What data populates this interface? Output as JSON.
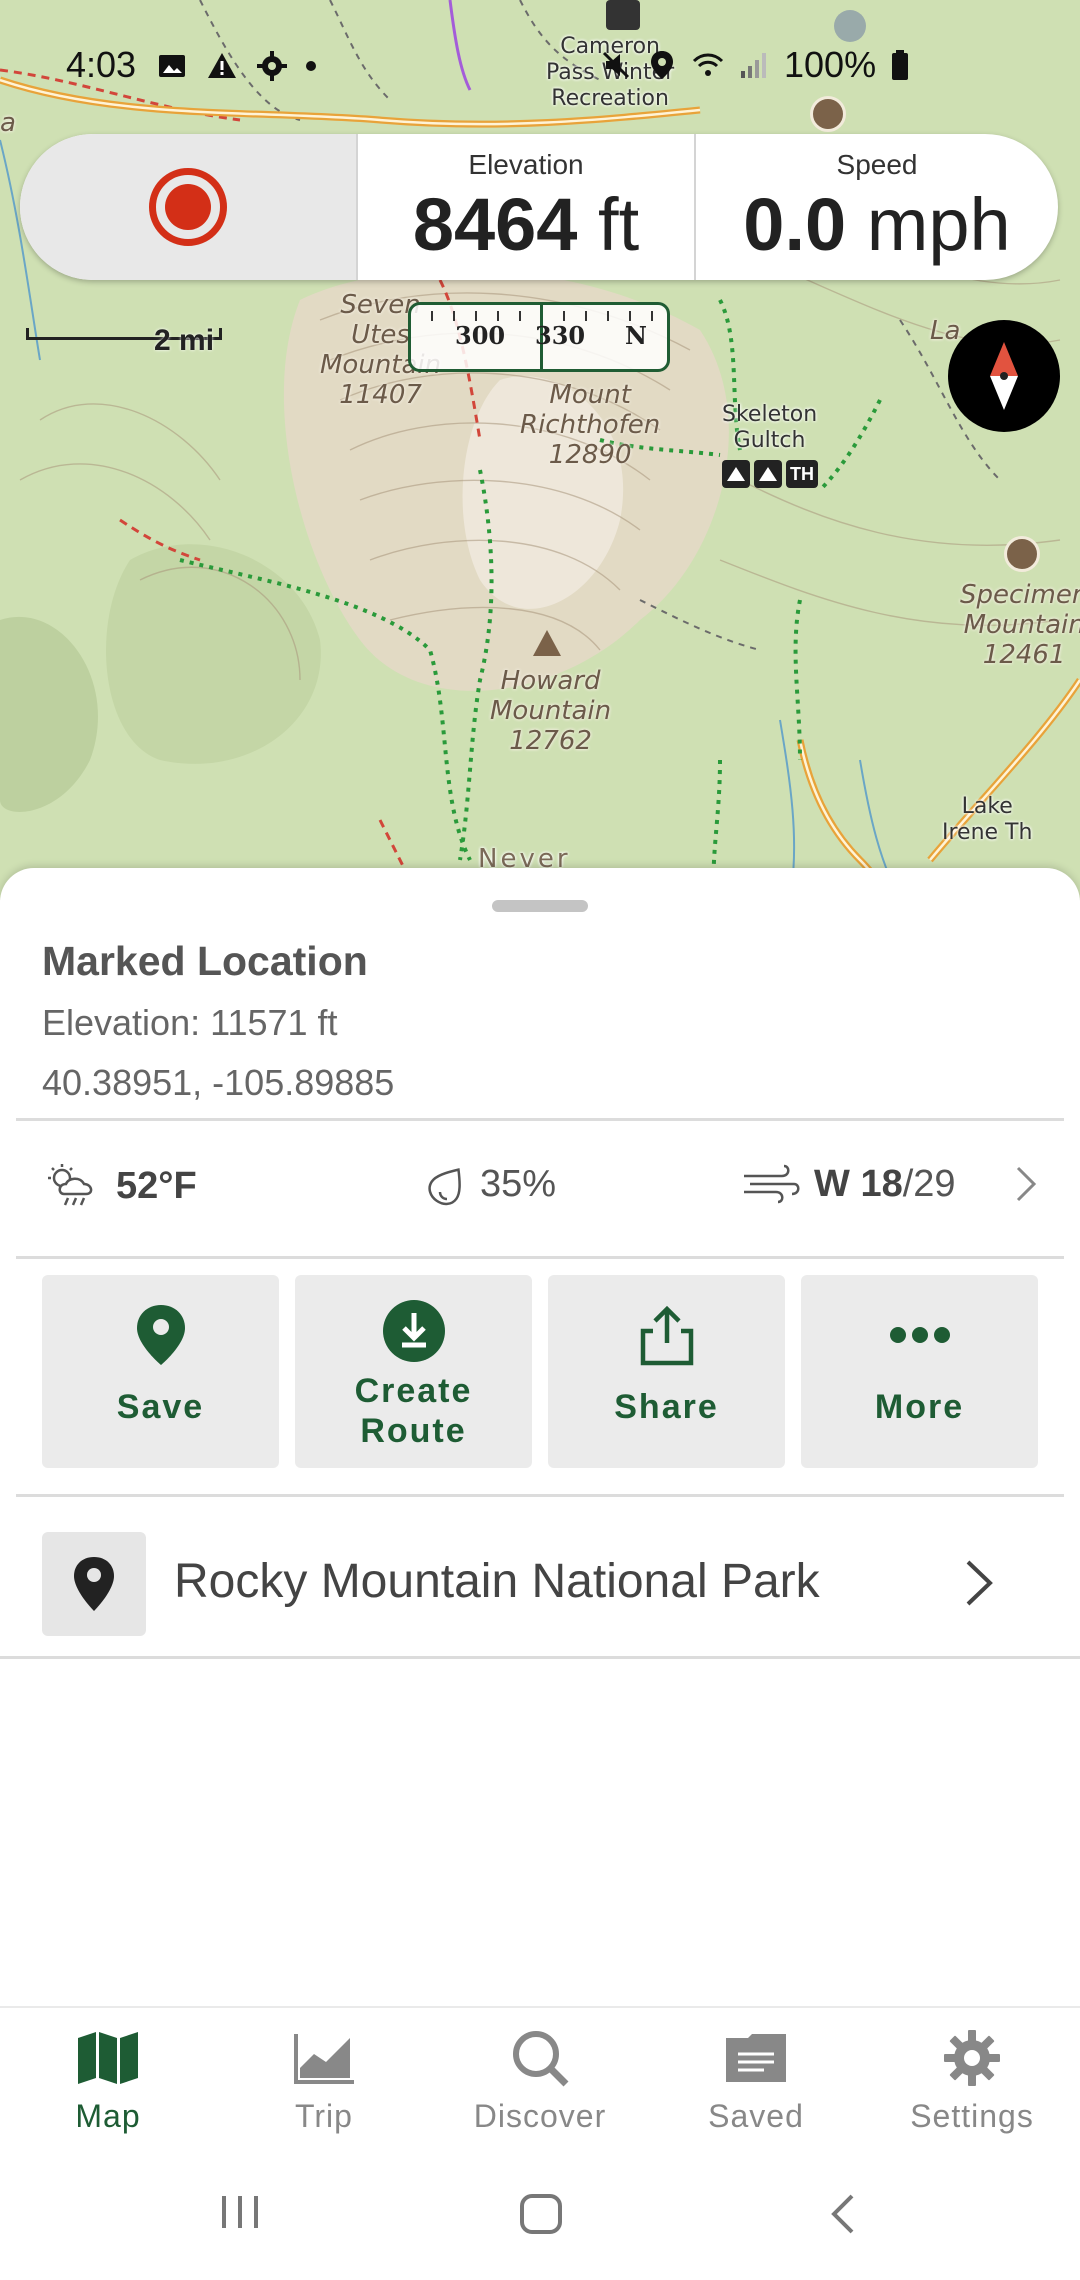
{
  "status_bar": {
    "time": "4:03",
    "battery": "100%",
    "icons": [
      "image-icon",
      "alert-icon",
      "settings-icon",
      "dot-icon",
      "mute-icon",
      "location-icon",
      "wifi-icon",
      "signal-icon",
      "battery-icon"
    ]
  },
  "recorder": {
    "elevation_label": "Elevation",
    "elevation_value": "8464",
    "elevation_unit": "ft",
    "speed_label": "Speed",
    "speed_value": "0.0",
    "speed_unit": "mph",
    "record_color": "#d32f17"
  },
  "map": {
    "scale_label": "2 mi",
    "heading_marks": [
      "300",
      "330",
      "N"
    ],
    "labels": {
      "cameron_pass": [
        "Cameron",
        "Pass Winter",
        "Recreation"
      ],
      "seven_utes": [
        "Seven",
        "Utes",
        "Mountain",
        "11407"
      ],
      "richthofen": [
        "Mount",
        "Richthofen",
        "12890"
      ],
      "skeleton": [
        "Skeleton",
        "Gultch"
      ],
      "specimen": [
        "Specimen",
        "Mountain",
        "12461"
      ],
      "howard": [
        "Howard",
        "Mountain",
        "12762"
      ],
      "never": "Never",
      "lake_irene": [
        "Lake",
        "Irene Th"
      ],
      "la": "La",
      "a": "a",
      "th_badge": "TH"
    }
  },
  "location": {
    "title": "Marked Location",
    "elevation": "Elevation: 11571 ft",
    "coordinates": "40.38951, -105.89885"
  },
  "weather": {
    "temperature": "52°F",
    "humidity": "35%",
    "wind_dir": "W",
    "wind_speed": "18",
    "wind_sep": "/",
    "wind_gust": "29"
  },
  "actions": [
    {
      "label": "Save",
      "icon": "pin-icon"
    },
    {
      "label": "Create",
      "label2": "Route",
      "icon": "download-icon"
    },
    {
      "label": "Share",
      "icon": "share-icon"
    },
    {
      "label": "More",
      "icon": "more-icon"
    }
  ],
  "park": {
    "name": "Rocky Mountain National Park",
    "icon": "location-pin-icon"
  },
  "nav": [
    {
      "label": "Map",
      "icon": "map-icon",
      "active": true
    },
    {
      "label": "Trip",
      "icon": "chart-icon",
      "active": false
    },
    {
      "label": "Discover",
      "icon": "search-icon",
      "active": false
    },
    {
      "label": "Saved",
      "icon": "folder-icon",
      "active": false
    },
    {
      "label": "Settings",
      "icon": "gear-icon",
      "active": false
    }
  ],
  "colors": {
    "accent_green": "#1e5c34",
    "map_base": "#cfe0b3",
    "trail_green": "#2a9a3a"
  }
}
